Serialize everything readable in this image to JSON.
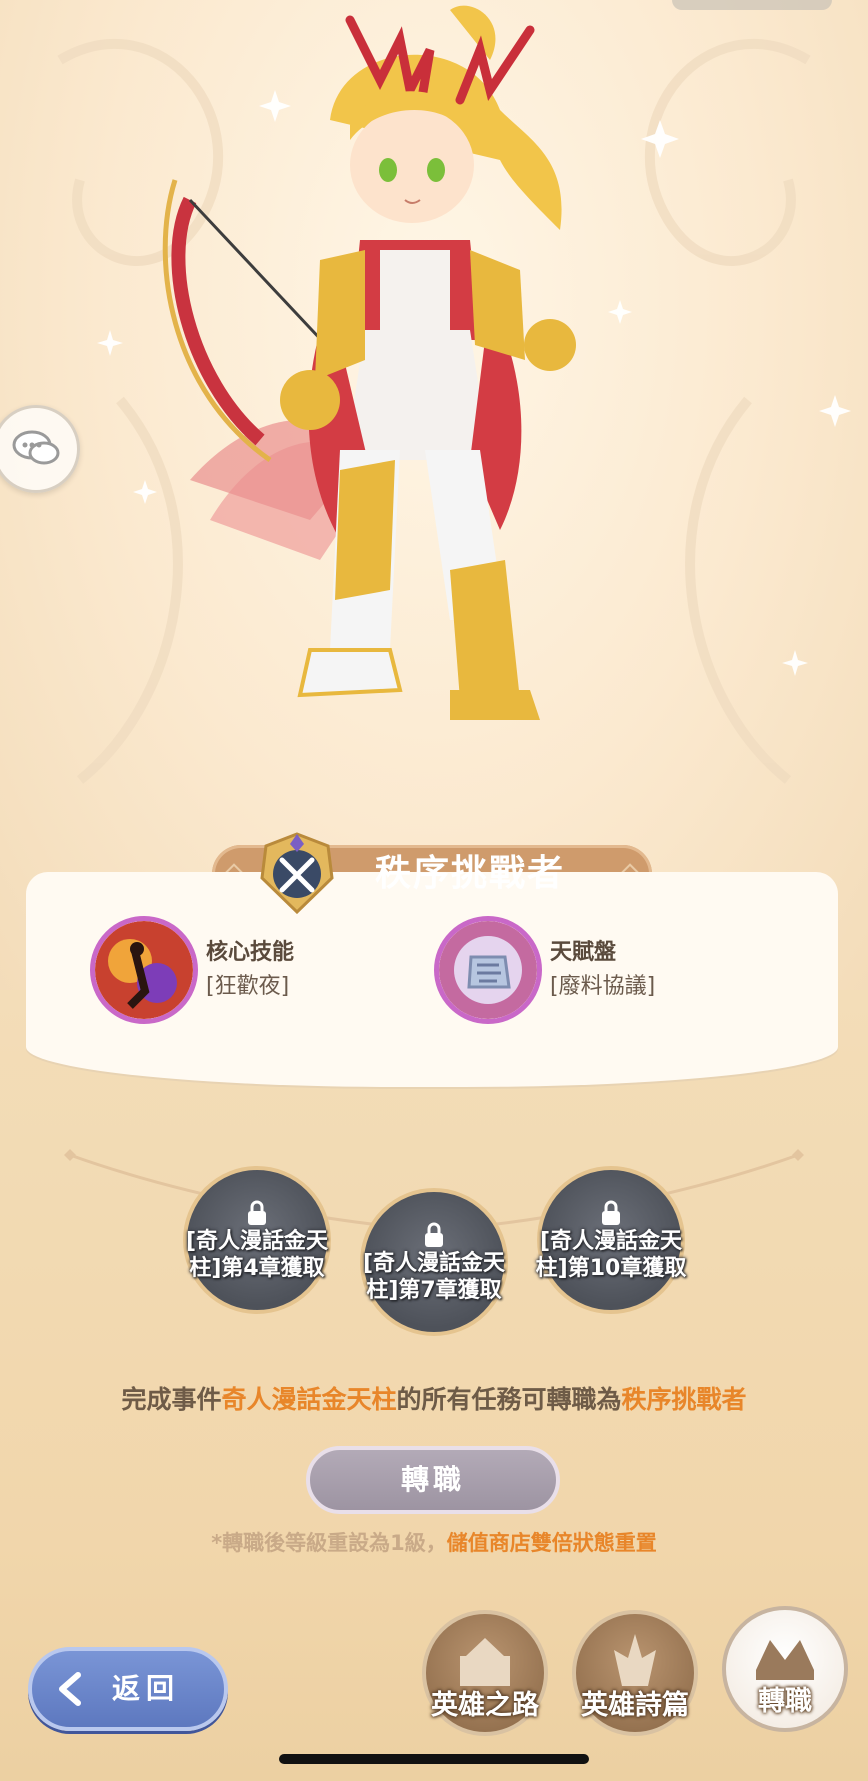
{
  "hero": {
    "class_title": "秩序挑戰者"
  },
  "skills": [
    {
      "title": "核心技能",
      "name": "[狂歡夜]",
      "icon": "core-skill-icon"
    },
    {
      "title": "天賦盤",
      "name": "[廢料協議]",
      "icon": "talent-disc-icon"
    }
  ],
  "nodes": [
    {
      "label_line1": "[奇人漫話金天",
      "label_line2": "柱]第4章獲取",
      "locked": true
    },
    {
      "label_line1": "[奇人漫話金天",
      "label_line2": "柱]第7章獲取",
      "locked": true
    },
    {
      "label_line1": "[奇人漫話金天",
      "label_line2": "柱]第10章獲取",
      "locked": true
    }
  ],
  "description": {
    "prefix": "完成事件",
    "event": "奇人漫話金天柱",
    "middle": "的所有任務可轉職為",
    "target": "秩序挑戰者"
  },
  "change_button_label": "轉職",
  "note": {
    "prefix": "*轉職後等級重設為1級，",
    "highlight": "儲值商店雙倍狀態重置"
  },
  "back_button_label": "返回",
  "bottom_nav": [
    {
      "label": "英雄之路",
      "icon": "hero-road-icon",
      "active": false
    },
    {
      "label": "英雄詩篇",
      "icon": "hero-epic-icon",
      "active": false
    },
    {
      "label": "轉職",
      "icon": "class-change-icon",
      "active": true
    }
  ],
  "colors": {
    "accent_orange": "#e8862a",
    "banner": "#cf9b6c",
    "back_button": "#6a85ca",
    "button_disabled": "#a8a0ad"
  }
}
